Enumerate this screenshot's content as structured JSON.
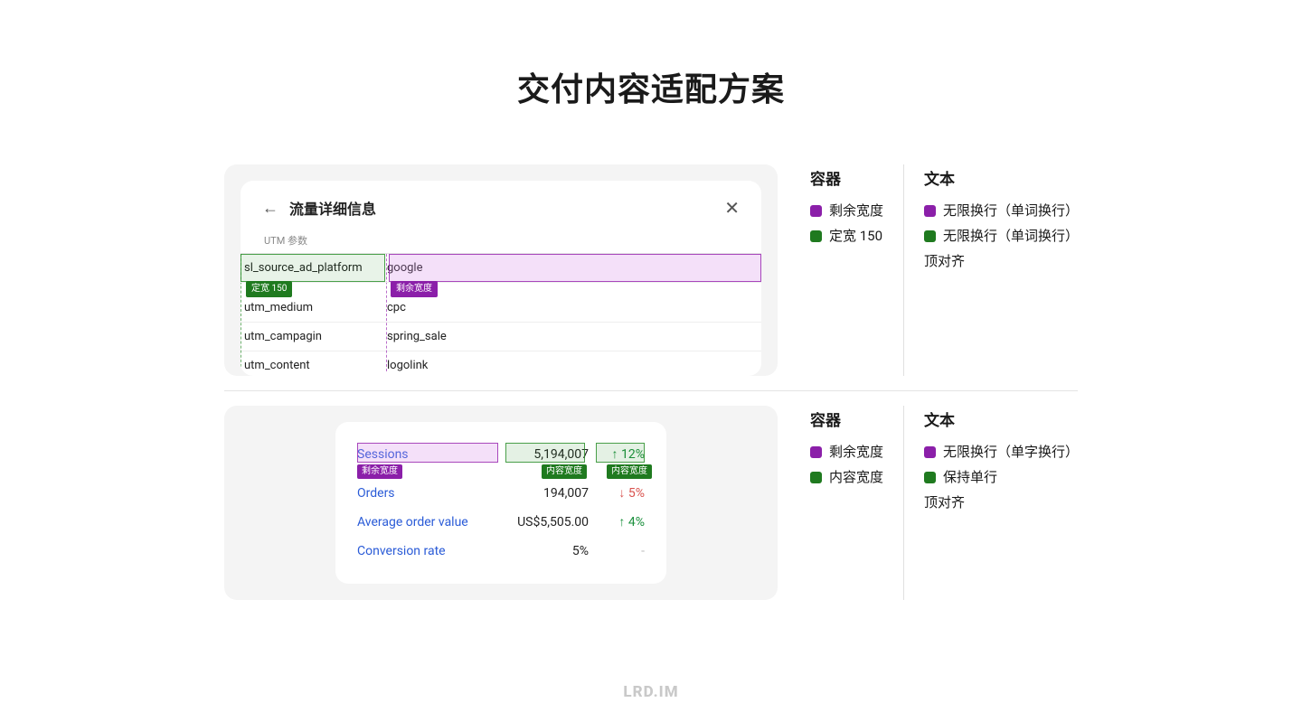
{
  "page_title": "交付内容适配方案",
  "footer_brand": "LRD.IM",
  "example1": {
    "card_title": "流量详细信息",
    "sublabel": "UTM 参数",
    "rows": [
      {
        "key": "sl_source_ad_platform",
        "val": "google"
      },
      {
        "key": "utm_medium",
        "val": "cpc"
      },
      {
        "key": "utm_campagin",
        "val": "spring_sale"
      },
      {
        "key": "utm_content",
        "val": "logolink"
      }
    ],
    "ann_left_tag": "定宽 150",
    "ann_right_tag": "剩余宽度"
  },
  "legend1": {
    "container_title": "容器",
    "container_items": [
      {
        "swatch": "purple",
        "label": "剩余宽度"
      },
      {
        "swatch": "green",
        "label": "定宽 150"
      }
    ],
    "text_title": "文本",
    "text_items": [
      {
        "swatch": "purple",
        "label": "无限换行（单词换行）"
      },
      {
        "swatch": "green",
        "label": "无限换行（单词换行）"
      }
    ],
    "text_note": "顶对齐"
  },
  "example2": {
    "rows": [
      {
        "label": "Sessions",
        "value": "5,194,007",
        "delta_dir": "up",
        "delta": "12%"
      },
      {
        "label": "Orders",
        "value": "194,007",
        "delta_dir": "down",
        "delta": "5%"
      },
      {
        "label": "Average order value",
        "value": "US$5,505.00",
        "delta_dir": "up",
        "delta": "4%"
      },
      {
        "label": "Conversion rate",
        "value": "5%",
        "delta_dir": "dash",
        "delta": "-"
      }
    ],
    "ann_label_tag": "剩余宽度",
    "ann_value_tag": "内容宽度",
    "ann_delta_tag": "内容宽度"
  },
  "legend2": {
    "container_title": "容器",
    "container_items": [
      {
        "swatch": "purple",
        "label": "剩余宽度"
      },
      {
        "swatch": "green",
        "label": "内容宽度"
      }
    ],
    "text_title": "文本",
    "text_items": [
      {
        "swatch": "purple",
        "label": "无限换行（单字换行）"
      },
      {
        "swatch": "green",
        "label": "保持单行"
      }
    ],
    "text_note": "顶对齐"
  }
}
